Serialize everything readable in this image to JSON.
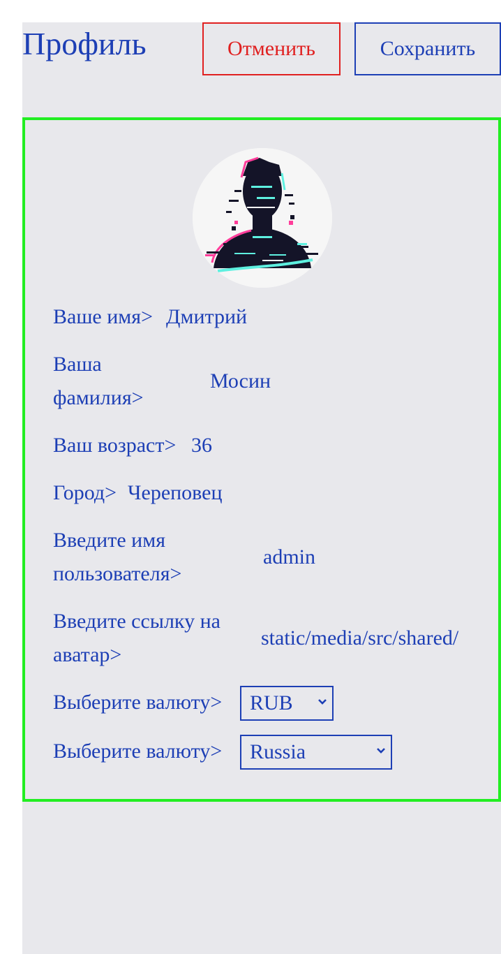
{
  "header": {
    "title": "Профиль",
    "cancel_label": "Отменить",
    "save_label": "Сохранить"
  },
  "form": {
    "name_label": "Ваше имя>",
    "name_value": "Дмитрий",
    "surname_label_line1": "Ваша",
    "surname_label_line2": "фамилия>",
    "surname_value": "Мосин",
    "age_label": "Ваш возраст>",
    "age_value": "36",
    "city_label": "Город>",
    "city_value": "Череповец",
    "username_label_line1": "Введите имя",
    "username_label_line2": "пользователя>",
    "username_value": "admin",
    "avatar_link_label_line1": "Введите ссылку на",
    "avatar_link_label_line2": "аватар>",
    "avatar_link_value": "static/media/src/shared/",
    "currency_label": "Выберите валюту>",
    "currency_value": "RUB",
    "country_label": "Выберите валюту>",
    "country_value": "Russia"
  },
  "colors": {
    "accent": "#1d3fb5",
    "cancel": "#e02020",
    "card_border": "#22ee22",
    "background": "#e8e8ec"
  }
}
